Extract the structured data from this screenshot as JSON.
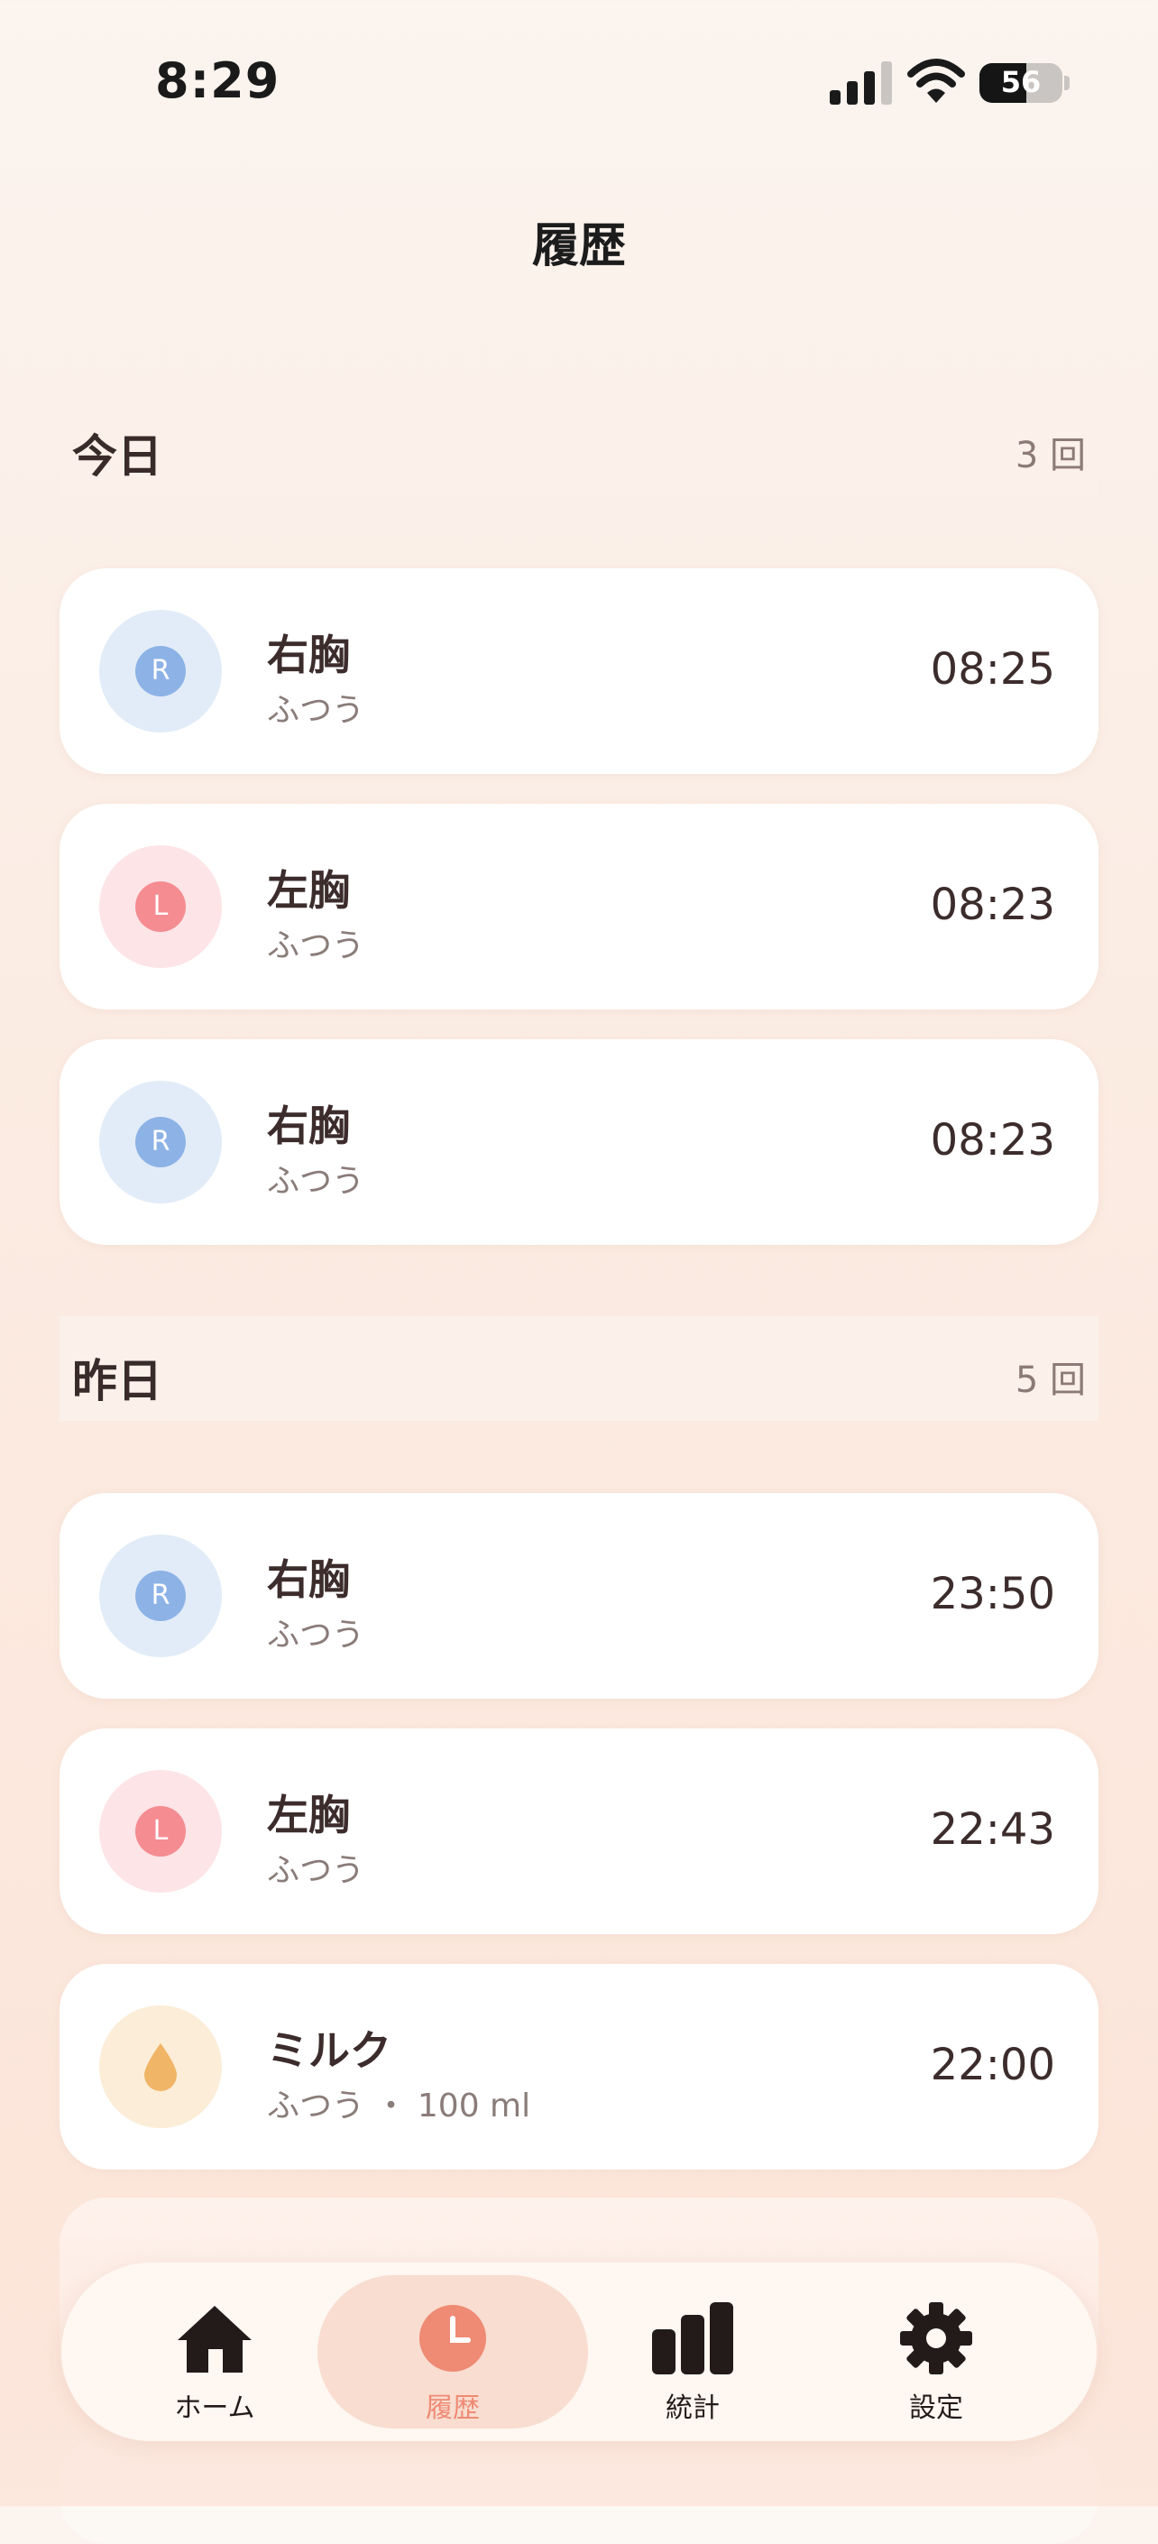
{
  "status_bar": {
    "time": "8:29",
    "battery": "56",
    "battery_level": 0.56
  },
  "nav": {
    "title": "履歴"
  },
  "sections": [
    {
      "title": "今日",
      "count": "3 回",
      "entries": [
        {
          "type": "right",
          "badge": "R",
          "title": "右胸",
          "subtitle": "ふつう",
          "time": "08:25"
        },
        {
          "type": "left",
          "badge": "L",
          "title": "左胸",
          "subtitle": "ふつう",
          "time": "08:23"
        },
        {
          "type": "right",
          "badge": "R",
          "title": "右胸",
          "subtitle": "ふつう",
          "time": "08:23"
        }
      ]
    },
    {
      "title": "昨日",
      "count": "5 回",
      "entries": [
        {
          "type": "right",
          "badge": "R",
          "title": "右胸",
          "subtitle": "ふつう",
          "time": "23:50"
        },
        {
          "type": "left",
          "badge": "L",
          "title": "左胸",
          "subtitle": "ふつう",
          "time": "22:43"
        },
        {
          "type": "milk",
          "title": "ミルク",
          "subtitle": "ふつう ・ 100 ml",
          "time": "22:00"
        }
      ]
    }
  ],
  "tabbar": {
    "active": "history",
    "tabs": [
      {
        "id": "home",
        "label": "ホーム",
        "icon": "home-icon"
      },
      {
        "id": "history",
        "label": "履歴",
        "icon": "clock-icon"
      },
      {
        "id": "stats",
        "label": "統計",
        "icon": "bar-chart-icon"
      },
      {
        "id": "settings",
        "label": "設定",
        "icon": "gear-icon"
      }
    ]
  },
  "colors": {
    "accent": "#ef8a74",
    "right_breast": "#8db3e6",
    "left_breast": "#f48c92",
    "milk": "#f0b566"
  }
}
